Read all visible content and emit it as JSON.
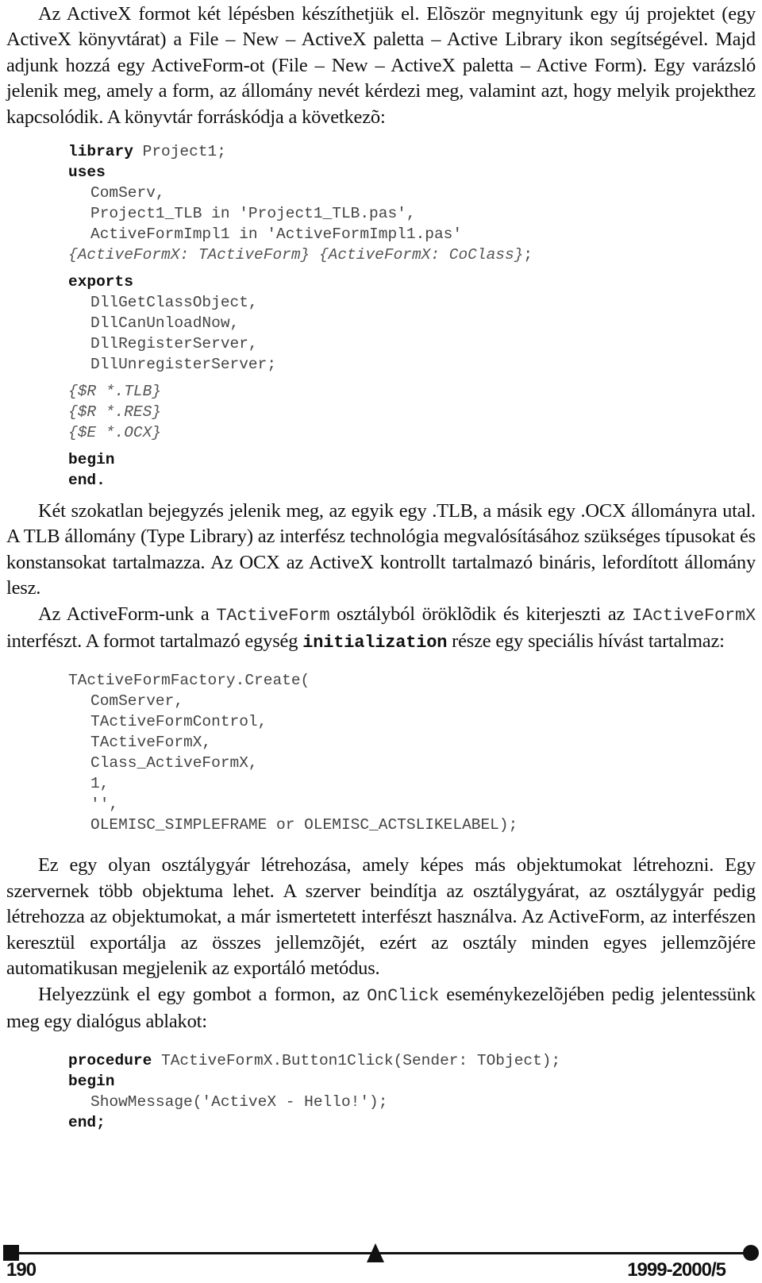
{
  "paragraphs": {
    "p1": "Az ActiveX formot két lépésben készíthetjük el. Elõször megnyitunk egy új projektet (egy ActiveX könyvtárat) a File – New – ActiveX paletta – Active Library ikon segítségével. Majd adjunk hozzá egy ActiveForm-ot (File – New – ActiveX paletta – Active Form). Egy varázsló jelenik meg, amely a form, az állomány nevét kérdezi meg, valamint azt, hogy melyik projekthez kapcsolódik. A könyvtár forráskódja a következõ:",
    "p2": "Két szokatlan bejegyzés jelenik meg, az egyik egy .TLB, a másik egy .OCX állományra utal. A TLB állomány (Type Library) az interfész technológia megvalósításához szükséges típusokat és konstansokat tartalmazza. Az OCX az ActiveX kontrollt tartalmazó bináris, lefordított állomány lesz.",
    "p3": {
      "t1": "Az ActiveForm-unk a ",
      "c1": "TActiveForm",
      "t2": " osztályból öröklõdik és kiterjeszti az ",
      "c2": "IActiveFormX",
      "t3": " interfészt. A formot tartalmazó egység ",
      "c3": "initialization",
      "t4": " része egy speciális hívást tartalmaz:"
    },
    "p4": "Ez egy olyan osztálygyár létrehozása, amely képes más objektumokat létrehozni. Egy szervernek több objektuma lehet. A szerver beindítja az osztálygyárat, az osztálygyár pedig létrehozza az objektumokat, a már ismertetett interfészt használva. Az ActiveForm, az interfészen keresztül exportálja az összes jellemzõjét, ezért az osztály minden egyes jellemzõjére automatikusan megjelenik az exportáló metódus.",
    "p5": {
      "t1": "Helyezzünk el egy gombot a formon, az ",
      "c1": "OnClick",
      "t2": " eseménykezelõjében pedig jelentessünk meg egy dialógus ablakot:"
    }
  },
  "code1": {
    "library_kw": "library",
    "library_name": " Project1;",
    "uses_kw": "uses",
    "uses_items": [
      "ComServ,",
      "Project1_TLB in 'Project1_TLB.pas',",
      "ActiveFormImpl1 in 'ActiveFormImpl1.pas'"
    ],
    "uses_comment": "{ActiveFormX: TActiveForm} {ActiveFormX: CoClass}",
    "uses_end": ";",
    "exports_kw": "exports",
    "exports_items": [
      "DllGetClassObject,",
      "DllCanUnloadNow,",
      "DllRegisterServer,",
      "DllUnregisterServer;"
    ],
    "directives": [
      "{$R *.TLB}",
      "{$R *.RES}",
      "{$E *.OCX}"
    ],
    "begin_kw": "begin",
    "end_kw": "end."
  },
  "code2": {
    "lines": [
      "TActiveFormFactory.Create(",
      "ComServer,",
      "TActiveFormControl,",
      "TActiveFormX,",
      "Class_ActiveFormX,",
      "1,",
      "'',",
      "OLEMISC_SIMPLEFRAME or OLEMISC_ACTSLIKELABEL);"
    ]
  },
  "code3": {
    "procedure_kw": "procedure",
    "procedure_sig": " TActiveFormX.Button1Click(Sender: TObject);",
    "begin_kw": "begin",
    "body": "ShowMessage('ActiveX - Hello!');",
    "end_kw": "end;"
  },
  "footer": {
    "page_number": "190",
    "issue": "1999-2000/5"
  }
}
